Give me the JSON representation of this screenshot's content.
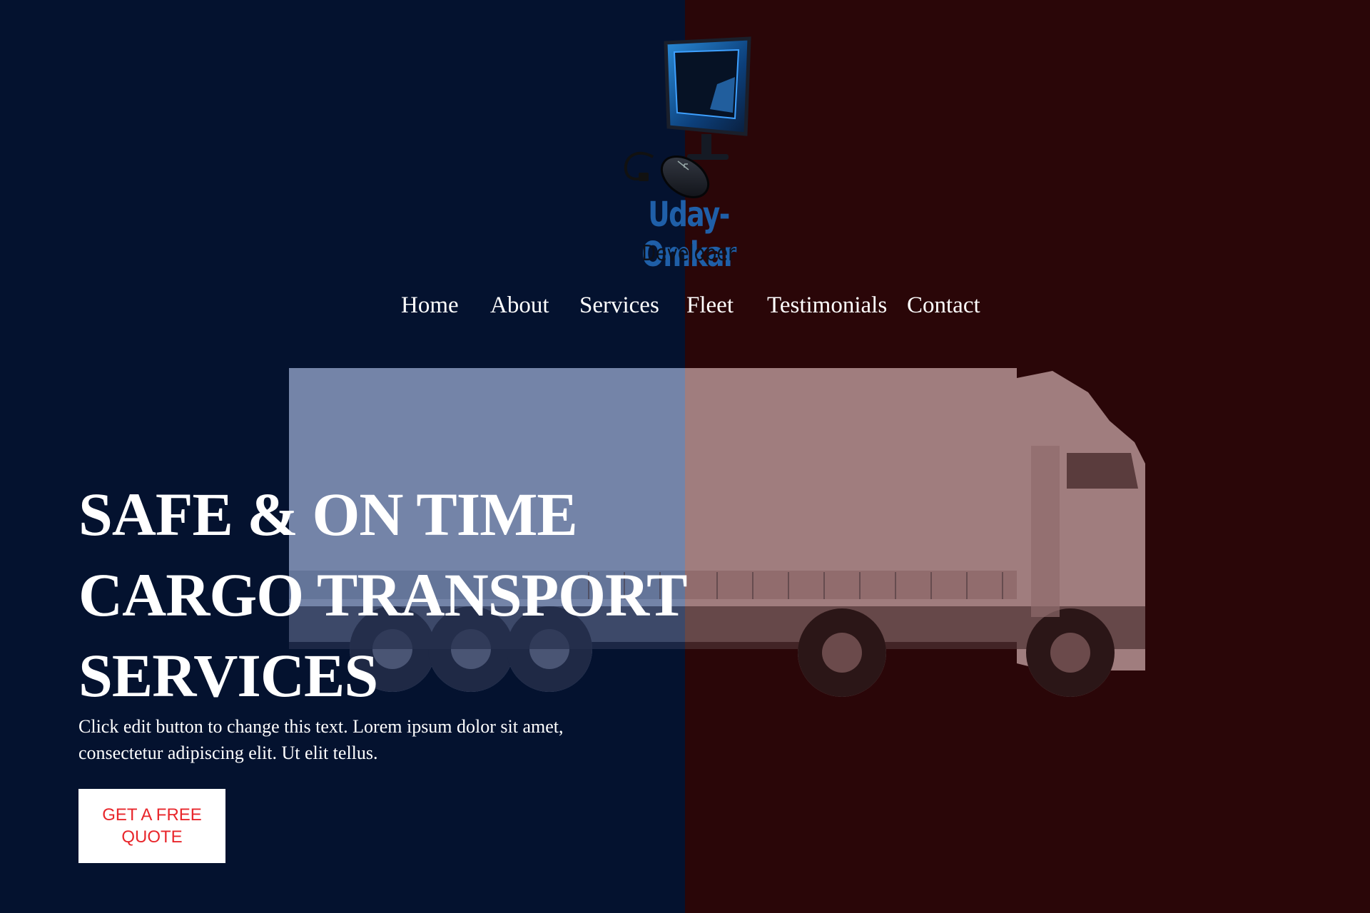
{
  "brand": {
    "name": "Uday-Omkar",
    "tagline": "Developer",
    "colors": {
      "name": "#1f5fa8",
      "tagline": "#0e1018"
    }
  },
  "nav": {
    "items": [
      {
        "label": "Home"
      },
      {
        "label": "About"
      },
      {
        "label": "Services"
      },
      {
        "label": "Fleet"
      },
      {
        "label": "Testimonials"
      },
      {
        "label": "Contact"
      }
    ]
  },
  "hero": {
    "title_lines": [
      "SAFE & ON TIME",
      "CARGO TRANSPORT",
      "SERVICES"
    ],
    "subtitle": "Click edit button to change this text. Lorem ipsum dolor sit amet, consectetur adipiscing elit. Ut elit tellus.",
    "cta_label": "GET A FREE QUOTE",
    "image": "semi-truck-image"
  },
  "colors": {
    "left_background": "#04122f",
    "right_background": "#2a0608",
    "cta_text": "#e8262b",
    "cta_background": "#ffffff"
  }
}
